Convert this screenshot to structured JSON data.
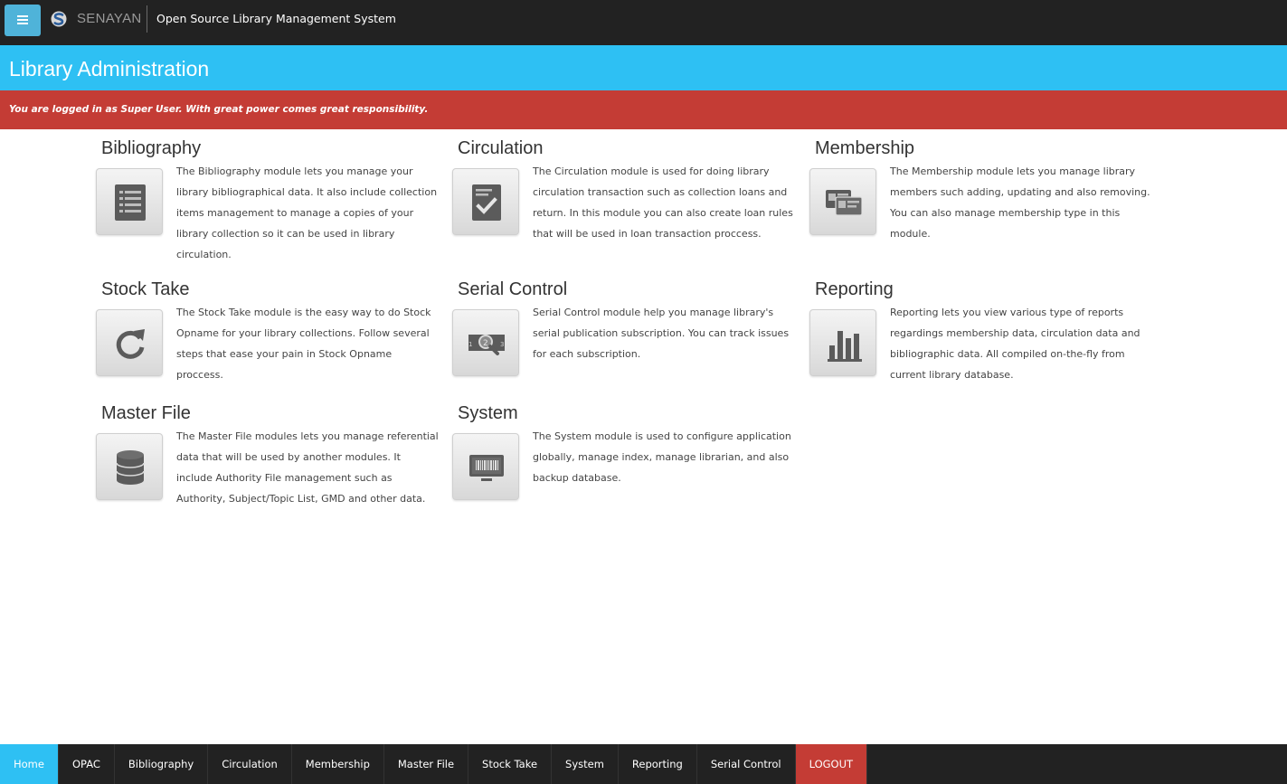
{
  "topbar": {
    "brand": "SENAYAN",
    "app_title": "Open Source Library Management System"
  },
  "header": {
    "title": "Library Administration"
  },
  "notice": {
    "text": "You are logged in as Super User. With great power comes great responsibility."
  },
  "modules": [
    {
      "title": "Bibliography",
      "icon": "list-document-icon",
      "description": "The Bibliography module lets you manage your library bibliographical data. It also include collection items management to manage a copies of your library collection so it can be used in library circulation."
    },
    {
      "title": "Circulation",
      "icon": "checkmark-document-icon",
      "description": "The Circulation module is used for doing library circulation transaction such as collection loans and return. In this module you can also create loan rules that will be used in loan transaction proccess."
    },
    {
      "title": "Membership",
      "icon": "member-cards-icon",
      "description": "The Membership module lets you manage library members such adding, updating and also removing. You can also manage membership type in this module."
    },
    {
      "title": "Stock Take",
      "icon": "refresh-icon",
      "description": "The Stock Take module is the easy way to do Stock Opname for your library collections. Follow several steps that ease your pain in Stock Opname proccess."
    },
    {
      "title": "Serial Control",
      "icon": "serial-magnifier-icon",
      "description": "Serial Control module help you manage library's serial publication subscription. You can track issues for each subscription."
    },
    {
      "title": "Reporting",
      "icon": "bar-chart-icon",
      "description": "Reporting lets you view various type of reports regardings membership data, circulation data and bibliographic data. All compiled on-the-fly from current library database."
    },
    {
      "title": "Master File",
      "icon": "database-icon",
      "description": "The Master File modules lets you manage referential data that will be used by another modules. It include Authority File management such as Authority, Subject/Topic List, GMD and other data."
    },
    {
      "title": "System",
      "icon": "barcode-monitor-icon",
      "description": "The System module is used to configure application globally, manage index, manage librarian, and also backup database."
    }
  ],
  "bottom_nav": {
    "items": [
      "Home",
      "OPAC",
      "Bibliography",
      "Circulation",
      "Membership",
      "Master File",
      "Stock Take",
      "System",
      "Reporting",
      "Serial Control"
    ],
    "logout": "LOGOUT",
    "active": "Home"
  },
  "colors": {
    "topbar": "#222222",
    "header": "#2ec0f3",
    "notice": "#c43c35",
    "menu_button": "#4fb3d9"
  }
}
